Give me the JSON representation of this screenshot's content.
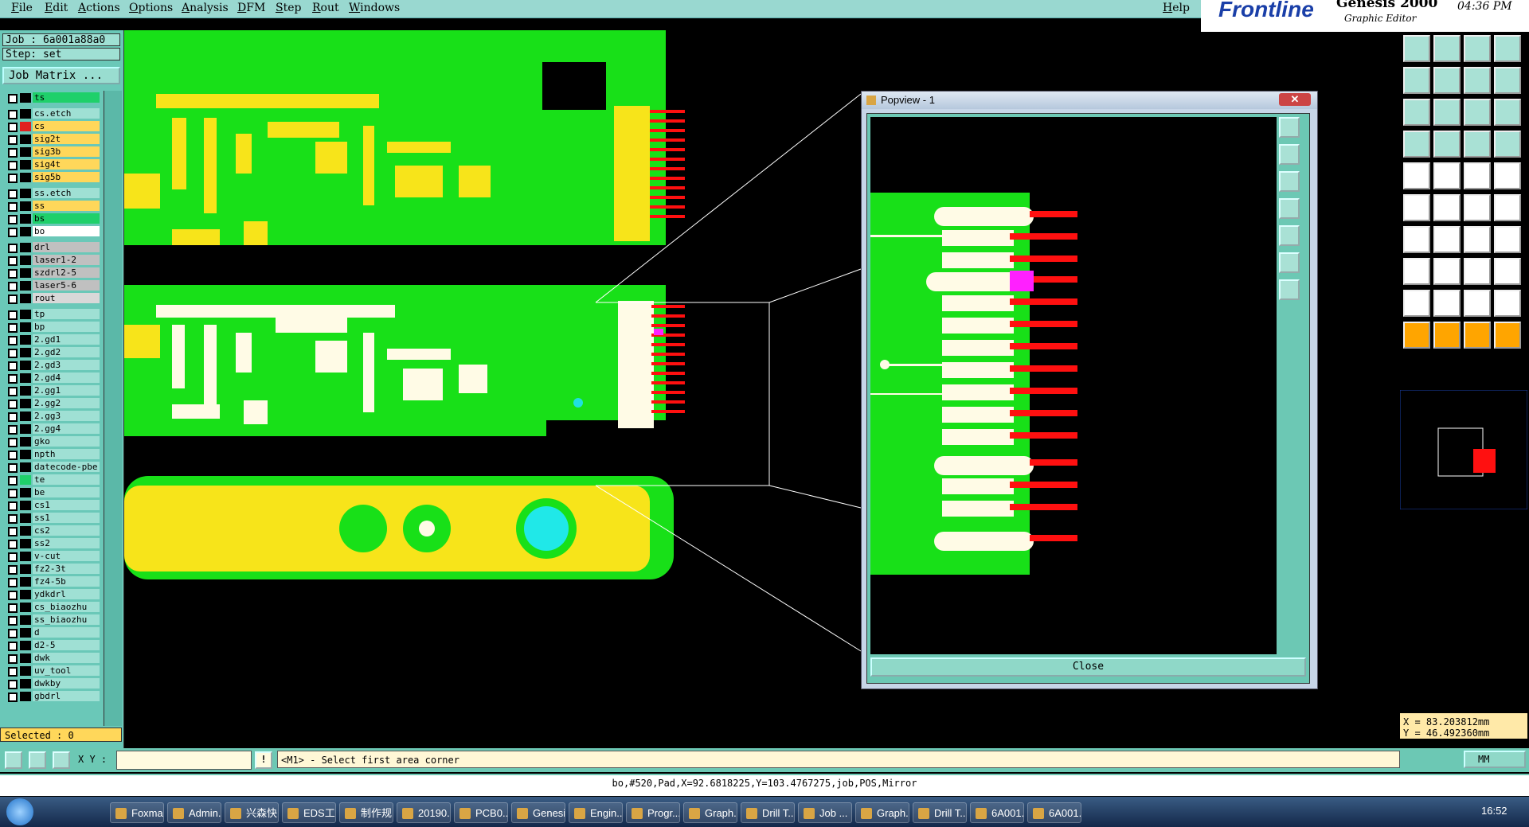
{
  "menu": {
    "items": [
      "File",
      "Edit",
      "Actions",
      "Options",
      "Analysis",
      "DFM",
      "Step",
      "Rout",
      "Windows"
    ],
    "help": "Help"
  },
  "brand": {
    "logo": "Frontline",
    "product": "Genesis 2000",
    "subtitle": "Graphic Editor",
    "time": "04:36 PM"
  },
  "job": {
    "job_line": "Job : 6a001a88a0",
    "step_line": "Step: set",
    "matrix_button": "Job Matrix ..."
  },
  "layers": [
    {
      "name": "ts",
      "swatch": "#000000",
      "bg": "#1fd06a"
    },
    {
      "name": "cs.etch",
      "swatch": "#000000",
      "bg": "#9fe0d4"
    },
    {
      "name": "cs",
      "swatch": "#e02020",
      "bg": "#ffd75a"
    },
    {
      "name": "sig2t",
      "swatch": "#000000",
      "bg": "#ffd75a"
    },
    {
      "name": "sig3b",
      "swatch": "#000000",
      "bg": "#ffd75a"
    },
    {
      "name": "sig4t",
      "swatch": "#000000",
      "bg": "#ffd75a"
    },
    {
      "name": "sig5b",
      "swatch": "#000000",
      "bg": "#ffd75a"
    },
    {
      "name": "ss.etch",
      "swatch": "#000000",
      "bg": "#9fe0d4"
    },
    {
      "name": "ss",
      "swatch": "#000000",
      "bg": "#ffd75a"
    },
    {
      "name": "bs",
      "swatch": "#000000",
      "bg": "#1fd06a"
    },
    {
      "name": "bo",
      "swatch": "#000000",
      "bg": "#ffffff"
    },
    {
      "name": "drl",
      "swatch": "#000000",
      "bg": "#c0c0c0"
    },
    {
      "name": "laser1-2",
      "swatch": "#000000",
      "bg": "#c0c0c0"
    },
    {
      "name": "szdrl2-5",
      "swatch": "#000000",
      "bg": "#c0c0c0"
    },
    {
      "name": "laser5-6",
      "swatch": "#000000",
      "bg": "#c0c0c0"
    },
    {
      "name": "rout",
      "swatch": "#000000",
      "bg": "#d8d8d8"
    },
    {
      "name": "tp",
      "swatch": "#000000",
      "bg": "#9fe0d4"
    },
    {
      "name": "bp",
      "swatch": "#000000",
      "bg": "#9fe0d4"
    },
    {
      "name": "2.gd1",
      "swatch": "#000000",
      "bg": "#9fe0d4"
    },
    {
      "name": "2.gd2",
      "swatch": "#000000",
      "bg": "#9fe0d4"
    },
    {
      "name": "2.gd3",
      "swatch": "#000000",
      "bg": "#9fe0d4"
    },
    {
      "name": "2.gd4",
      "swatch": "#000000",
      "bg": "#9fe0d4"
    },
    {
      "name": "2.gg1",
      "swatch": "#000000",
      "bg": "#9fe0d4"
    },
    {
      "name": "2.gg2",
      "swatch": "#000000",
      "bg": "#9fe0d4"
    },
    {
      "name": "2.gg3",
      "swatch": "#000000",
      "bg": "#9fe0d4"
    },
    {
      "name": "2.gg4",
      "swatch": "#000000",
      "bg": "#9fe0d4"
    },
    {
      "name": "gko",
      "swatch": "#000000",
      "bg": "#9fe0d4"
    },
    {
      "name": "npth",
      "swatch": "#000000",
      "bg": "#9fe0d4"
    },
    {
      "name": "datecode-pbe",
      "swatch": "#000000",
      "bg": "#9fe0d4"
    },
    {
      "name": "te",
      "swatch": "#1fd06a",
      "bg": "#9fe0d4"
    },
    {
      "name": "be",
      "swatch": "#000000",
      "bg": "#9fe0d4"
    },
    {
      "name": "cs1",
      "swatch": "#000000",
      "bg": "#9fe0d4"
    },
    {
      "name": "ss1",
      "swatch": "#000000",
      "bg": "#9fe0d4"
    },
    {
      "name": "cs2",
      "swatch": "#000000",
      "bg": "#9fe0d4"
    },
    {
      "name": "ss2",
      "swatch": "#000000",
      "bg": "#9fe0d4"
    },
    {
      "name": "v-cut",
      "swatch": "#000000",
      "bg": "#9fe0d4"
    },
    {
      "name": "fz2-3t",
      "swatch": "#000000",
      "bg": "#9fe0d4"
    },
    {
      "name": "fz4-5b",
      "swatch": "#000000",
      "bg": "#9fe0d4"
    },
    {
      "name": "ydkdrl",
      "swatch": "#000000",
      "bg": "#9fe0d4"
    },
    {
      "name": "cs_biaozhu",
      "swatch": "#000000",
      "bg": "#9fe0d4"
    },
    {
      "name": "ss_biaozhu",
      "swatch": "#000000",
      "bg": "#9fe0d4"
    },
    {
      "name": "d",
      "swatch": "#000000",
      "bg": "#9fe0d4"
    },
    {
      "name": "d2-5",
      "swatch": "#000000",
      "bg": "#9fe0d4"
    },
    {
      "name": "dwk",
      "swatch": "#000000",
      "bg": "#9fe0d4"
    },
    {
      "name": "uv_tool",
      "swatch": "#000000",
      "bg": "#9fe0d4"
    },
    {
      "name": "dwkby",
      "swatch": "#000000",
      "bg": "#9fe0d4"
    },
    {
      "name": "gbdrl",
      "swatch": "#000000",
      "bg": "#9fe0d4"
    }
  ],
  "selected": "Selected : 0",
  "popview": {
    "title": "Popview - 1",
    "close_label": "Close"
  },
  "coords": {
    "x": "X = 83.203812mm",
    "y": "Y = 46.492360mm"
  },
  "command": {
    "xy_label": "X Y :",
    "prompt": "<M1> - Select first area corner",
    "units": "MM"
  },
  "status": "bo,#520,Pad,X=92.6818225,Y=103.4767275,job,POS,Mirror",
  "taskbar": {
    "items": [
      "Foxmail",
      "Admin...",
      "兴森快...",
      "EDS工...",
      "制作规...",
      "20190...",
      "PCB0...",
      "Genesis",
      "Engin...",
      "Progr...",
      "Graph...",
      "Drill T...",
      "Job ...",
      "Graph...",
      "Drill T...",
      "6A001...",
      "6A001..."
    ],
    "clock": "16:52"
  },
  "colors": {
    "board_green": "#18e018",
    "copper_yellow": "#f7e41a",
    "pad_red": "#ff1010",
    "mask_white": "#fffbe6"
  }
}
